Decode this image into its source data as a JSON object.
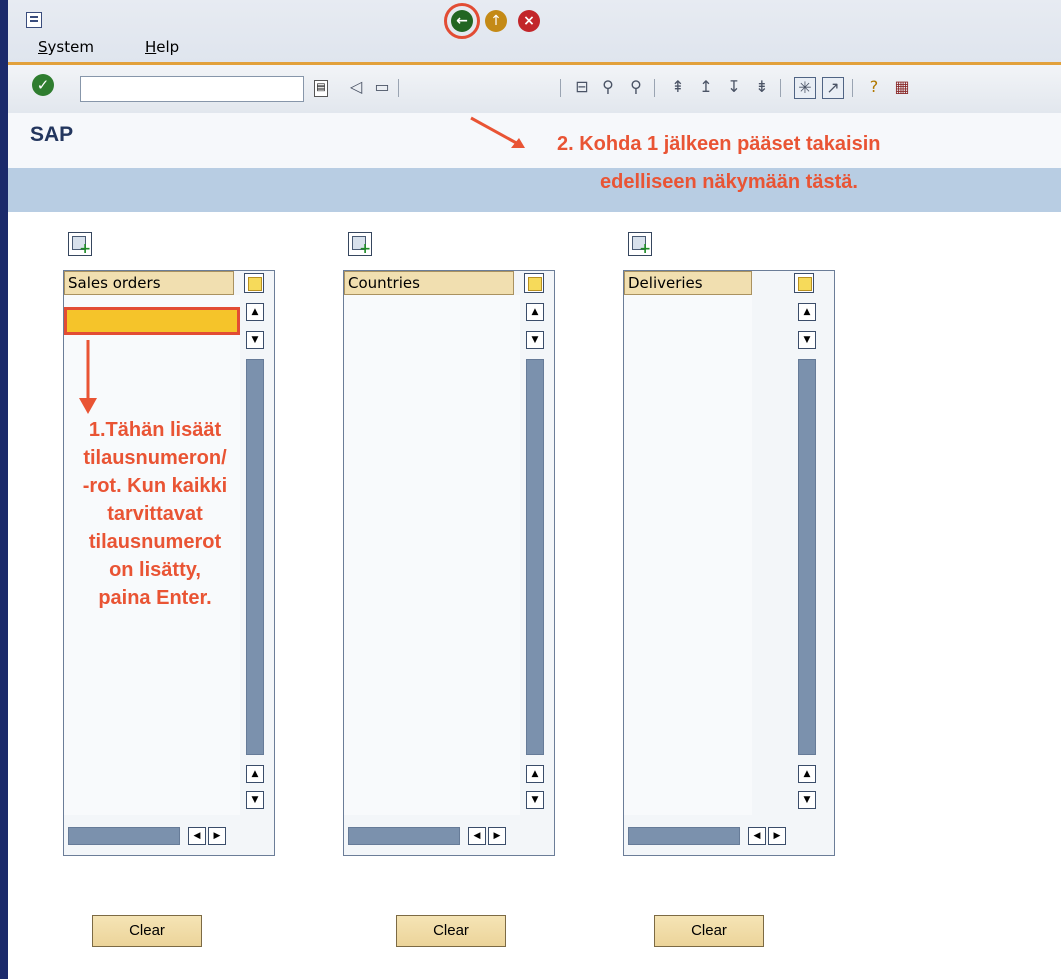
{
  "menu": {
    "items": [
      {
        "label": "System",
        "underline": "S",
        "rest": "ystem"
      },
      {
        "label": "Help",
        "underline": "H",
        "rest": "elp"
      }
    ]
  },
  "toolbar": {
    "command_value": "",
    "icons": [
      "enter-icon",
      "command-dropdown-icon",
      "back-arrow-icon",
      "save-icon",
      "back-icon",
      "exit-icon",
      "cancel-icon",
      "print-icon",
      "find-icon",
      "find-next-icon",
      "first-page-icon",
      "previous-page-icon",
      "next-page-icon",
      "last-page-icon",
      "create-session-icon",
      "shortcut-icon",
      "help-icon",
      "customize-layout-icon"
    ]
  },
  "title": {
    "text": "SAP"
  },
  "annotations": {
    "step2_line1": "2. Kohda 1 jälkeen pääset takaisin",
    "step2_line2": "edelliseen näkymään tästä.",
    "step1_lines": [
      "1.Tähän lisäät",
      "tilausnumeron/",
      "-rot. Kun kaikki",
      "tarvittavat",
      "tilausnumerot",
      "on lisätty,",
      "paina Enter."
    ],
    "color": "#e95434"
  },
  "panels": [
    {
      "header": "Sales orders",
      "clear_label": "Clear"
    },
    {
      "header": "Countries",
      "clear_label": "Clear"
    },
    {
      "header": "Deliveries",
      "clear_label": "Clear"
    }
  ],
  "colors": {
    "frame": "#1b2a6b",
    "accent_orange": "#e2a13b",
    "header_bar": "#b8cde3",
    "scroll_track": "#7b91ad",
    "button": "#ecd49a",
    "highlight": "#e24c34"
  }
}
